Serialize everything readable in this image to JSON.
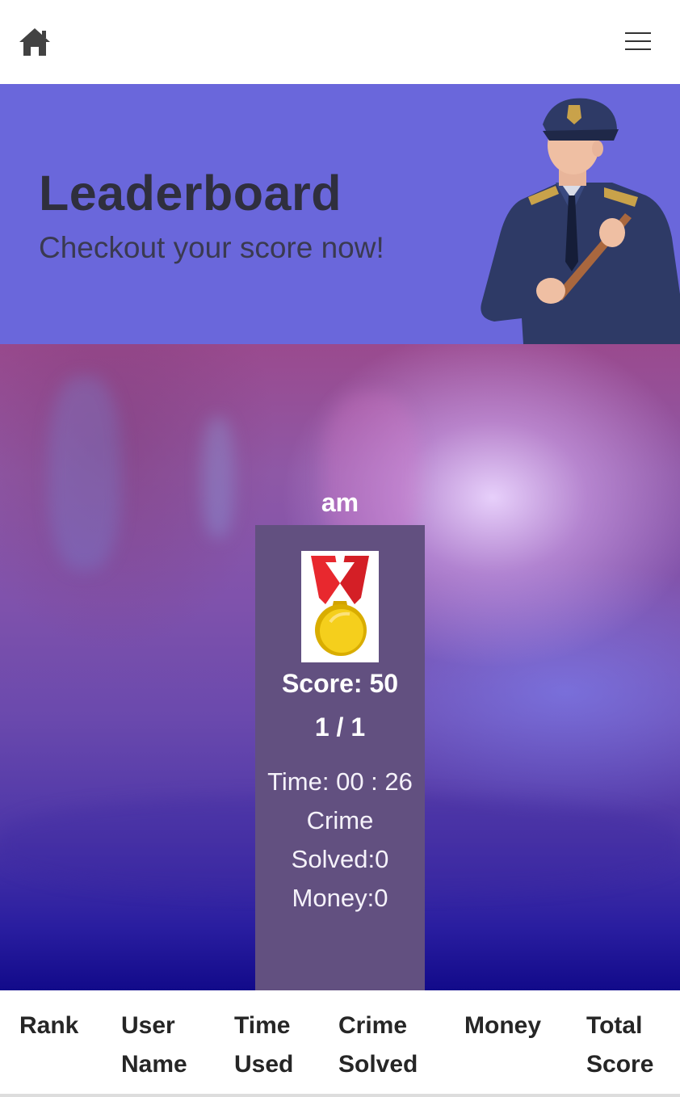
{
  "nav": {
    "home_icon": "home-icon",
    "menu_icon": "hamburger-menu-icon"
  },
  "banner": {
    "title": "Leaderboard",
    "subtitle": "Checkout your score now!",
    "background_color": "#6a67db"
  },
  "top_player": {
    "name": "am",
    "score_text": "Score: 50",
    "rank_text": "1 / 1",
    "time_text": "Time: 00 : 26",
    "crime_text": "Crime Solved:0",
    "money_text": "Money:0",
    "medal_icon": "gold-medal-icon"
  },
  "table": {
    "headers": [
      [
        "Rank"
      ],
      [
        "User",
        "Name"
      ],
      [
        "Time",
        "Used"
      ],
      [
        "Crime",
        "Solved"
      ],
      [
        "Money"
      ],
      [
        "Total",
        "Score"
      ]
    ]
  }
}
